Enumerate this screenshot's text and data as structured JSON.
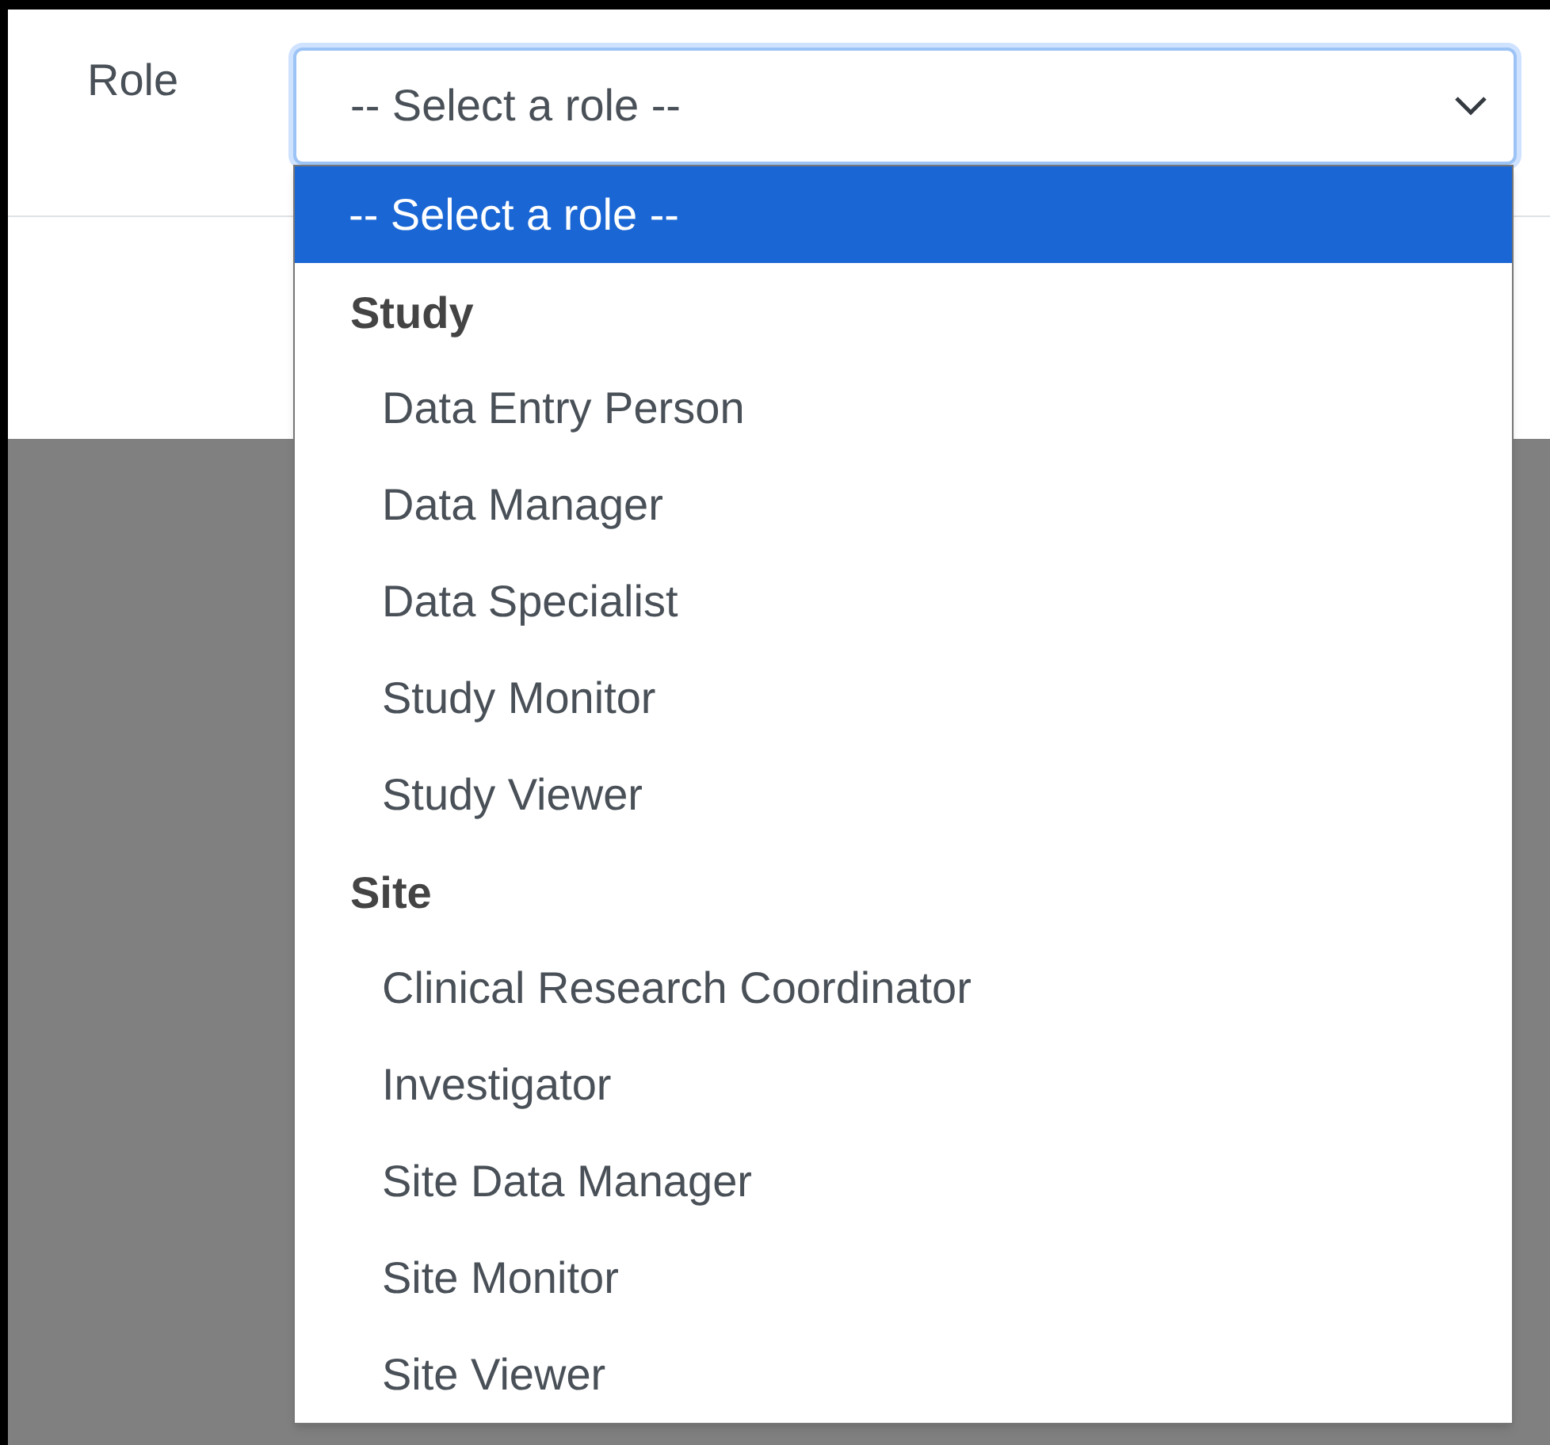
{
  "field": {
    "label": "Role",
    "value": "-- Select a role --",
    "expanded": true
  },
  "dropdown": {
    "options": [
      {
        "label": "-- Select a role --",
        "selected": true
      }
    ],
    "groups": [
      {
        "label": "Study",
        "options": [
          {
            "label": "Data Entry Person",
            "selected": false
          },
          {
            "label": "Data Manager",
            "selected": false
          },
          {
            "label": "Data Specialist",
            "selected": false
          },
          {
            "label": "Study Monitor",
            "selected": false
          },
          {
            "label": "Study Viewer",
            "selected": false
          }
        ]
      },
      {
        "label": "Site",
        "options": [
          {
            "label": "Clinical Research Coordinator",
            "selected": false
          },
          {
            "label": "Investigator",
            "selected": false
          },
          {
            "label": "Site Data Manager",
            "selected": false
          },
          {
            "label": "Site Monitor",
            "selected": false
          },
          {
            "label": "Site Viewer",
            "selected": false
          }
        ]
      }
    ]
  }
}
